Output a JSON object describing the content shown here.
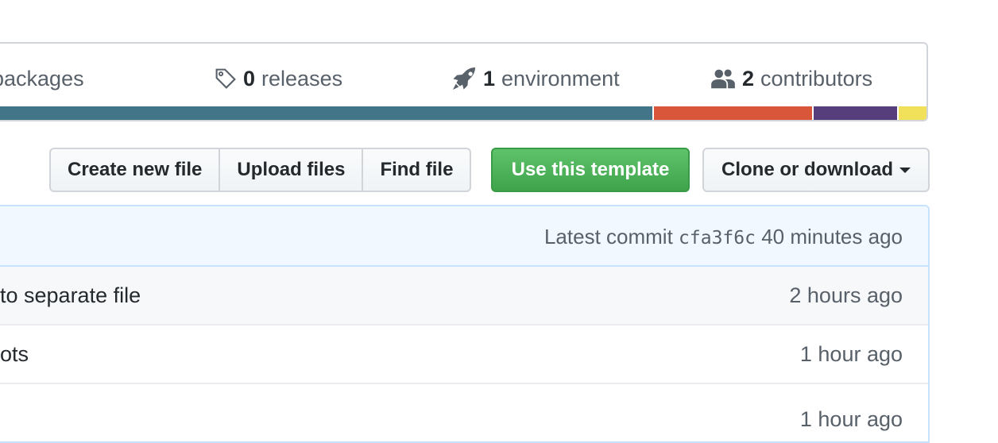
{
  "summary": {
    "packages": {
      "label": "packages"
    },
    "releases": {
      "count": "0",
      "label": "releases"
    },
    "environment": {
      "count": "1",
      "label": "environment"
    },
    "contributors": {
      "count": "2",
      "label": "contributors"
    }
  },
  "language_bar": {
    "colors": [
      "#427588",
      "#d9563a",
      "#563d7c",
      "#f1e05a"
    ],
    "fractions": [
      0.71,
      0.17,
      0.09,
      0.03
    ]
  },
  "toolbar": {
    "create_new_file": "Create new file",
    "upload_files": "Upload files",
    "find_file": "Find file",
    "use_template": "Use this template",
    "clone_or_download": "Clone or download"
  },
  "commit_bar": {
    "prefix": "Latest commit",
    "sha": "cfa3f6c",
    "age": "40 minutes ago"
  },
  "rows": [
    {
      "message": "to separate file",
      "age": "2 hours ago"
    },
    {
      "message": "ots",
      "age": "1 hour ago"
    },
    {
      "message": "",
      "age": "1 hour ago"
    }
  ],
  "colors": {
    "green_button": "#4cb35a",
    "commit_bar_bg": "#f1f8ff",
    "row_alt_bg": "#f6f8fa"
  }
}
